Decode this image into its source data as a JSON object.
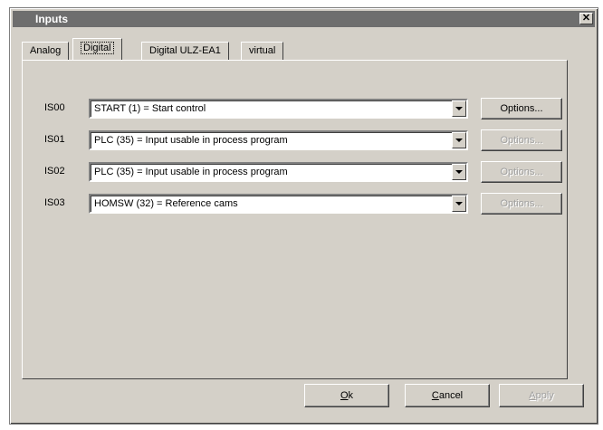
{
  "window": {
    "title": "Inputs",
    "close_glyph": "✕"
  },
  "tabs": [
    {
      "label": "Analog",
      "active": false
    },
    {
      "label": "Digital",
      "active": true
    },
    {
      "label": "Digital ULZ-EA1",
      "active": false
    },
    {
      "label": "virtual",
      "active": false
    }
  ],
  "rows": [
    {
      "label": "IS00",
      "value": "START (1) = Start control",
      "options_label": "Options...",
      "options_enabled": true
    },
    {
      "label": "IS01",
      "value": "PLC (35) = Input usable in process program",
      "options_label": "Options...",
      "options_enabled": false
    },
    {
      "label": "IS02",
      "value": "PLC (35) = Input usable in process program",
      "options_label": "Options...",
      "options_enabled": false
    },
    {
      "label": "IS03",
      "value": "HOMSW (32) = Reference cams",
      "options_label": "Options...",
      "options_enabled": false
    }
  ],
  "footer": {
    "ok_label": "Ok",
    "cancel_label": "Cancel",
    "apply_label": "Apply",
    "apply_enabled": false
  },
  "icons": {
    "dropdown": "chevron-down-icon",
    "close": "close-icon"
  }
}
